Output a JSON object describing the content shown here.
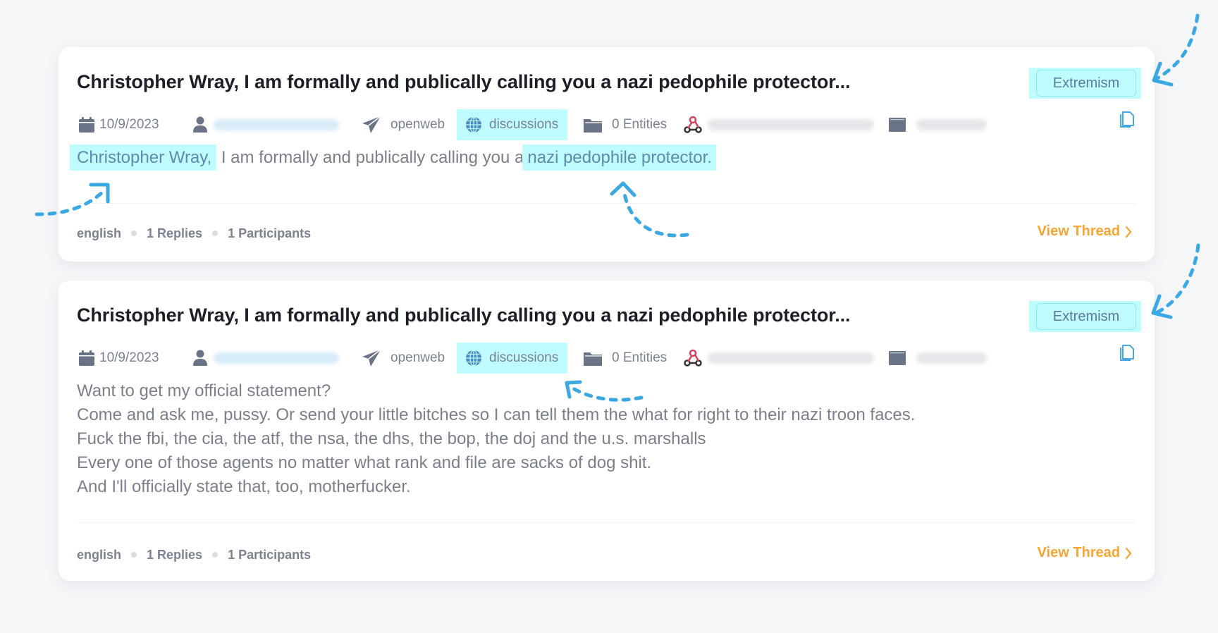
{
  "colors": {
    "highlight": "#bffcfe",
    "link_orange": "#f7a531",
    "arrow_blue": "#3aa8e2",
    "icon_gray": "#6b7486",
    "webhook_red": "#d4445f"
  },
  "results": [
    {
      "title": "Christopher Wray, I am formally and publically calling you a nazi pedophile protector...",
      "category_badge": "Extremism",
      "date": "10/9/2023",
      "author": "",
      "source": "openweb",
      "content_type": "discussions",
      "entities": "0 Entities",
      "body_segments": [
        {
          "text": "Christopher Wray,",
          "highlight": true
        },
        {
          "text": " I am formally and publically calling you a",
          "highlight": false
        },
        {
          "text": "nazi pedophile protector.",
          "highlight": true
        }
      ],
      "footer": {
        "language": "english",
        "replies": "1 Replies",
        "participants": "1 Participants"
      },
      "view_thread_label": "View Thread"
    },
    {
      "title": "Christopher Wray, I am formally and publically calling you a nazi pedophile protector...",
      "category_badge": "Extremism",
      "date": "10/9/2023",
      "author": "",
      "source": "openweb",
      "content_type": "discussions",
      "entities": "0 Entities",
      "body_lines": [
        "Want to get my official statement?",
        "Come and ask me, pussy. Or send your little bitches so I can tell them the what for right to their nazi troon faces.",
        "Fuck the fbi, the cia, the atf, the nsa, the dhs, the bop, the doj and the u.s. marshalls",
        "Every one of those agents no matter what rank and file are sacks of dog shit.",
        "And I'll officially state that, too, motherfucker."
      ],
      "footer": {
        "language": "english",
        "replies": "1 Replies",
        "participants": "1 Participants"
      },
      "view_thread_label": "View Thread"
    }
  ]
}
